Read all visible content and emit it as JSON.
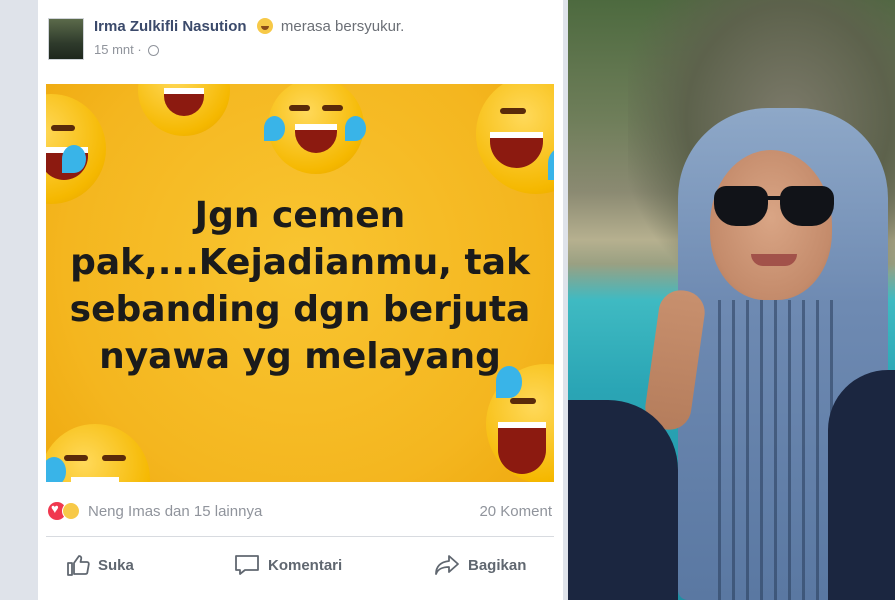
{
  "post": {
    "author": "Irma Zulkifli Nasution",
    "feeling": "merasa bersyukur.",
    "timestamp": "15 mnt · ",
    "meme_lines": [
      "Jgn cemen",
      "pak,...Kejadianmu, tak",
      "sebanding dgn berjuta",
      "nyawa yg melayang"
    ],
    "reactions_text": "Neng Imas dan 15 lainnya",
    "comment_count": "20 Koment",
    "actions": {
      "like": "Suka",
      "comment": "Komentari",
      "share": "Bagikan"
    }
  },
  "colors": {
    "meme_background": "#f4b61f",
    "author_link": "#3b4a6b",
    "muted_text": "#90949c"
  },
  "icons": [
    "globe-icon",
    "like-icon",
    "comment-icon",
    "share-icon",
    "love-reaction-icon",
    "haha-reaction-icon"
  ]
}
